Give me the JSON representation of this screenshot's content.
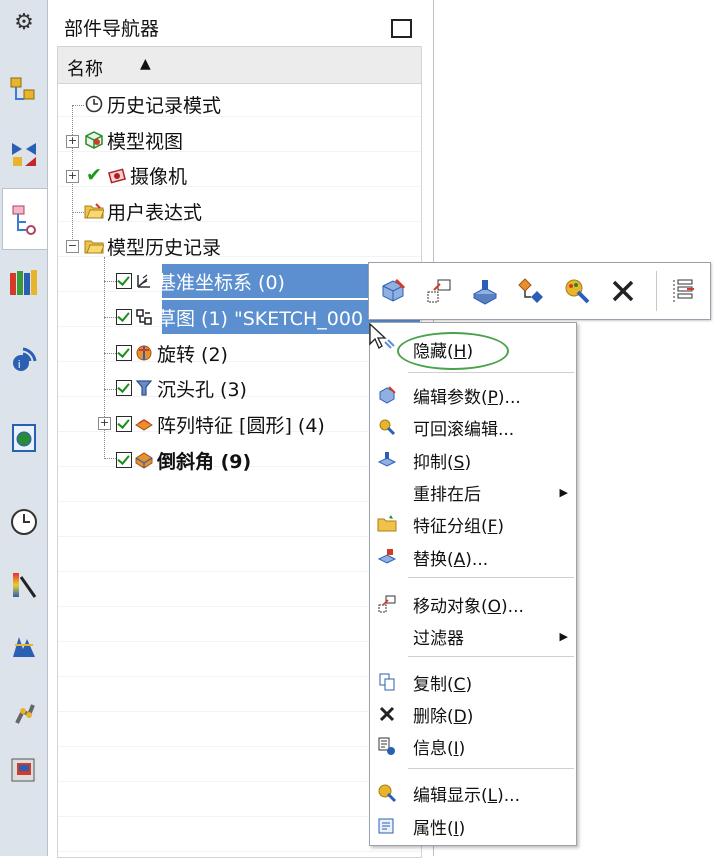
{
  "navigator": {
    "title": "部件导航器",
    "column_header": "名称",
    "nodes": [
      {
        "label": "历史记录模式",
        "icon": "clock-icon"
      },
      {
        "label": "模型视图",
        "icon": "model-view-icon"
      },
      {
        "label": "摄像机",
        "icon": "camera-icon"
      },
      {
        "label": "用户表达式",
        "icon": "folder-icon"
      },
      {
        "label": "模型历史记录",
        "icon": "folder-open-icon"
      },
      {
        "label": "基准坐标系 (0)",
        "icon": "datum-csys-icon"
      },
      {
        "label": "草图 (1) \"SKETCH_000",
        "icon": "sketch-icon"
      },
      {
        "label": "旋转 (2)",
        "icon": "revolve-icon"
      },
      {
        "label": "沉头孔 (3)",
        "icon": "countersink-hole-icon"
      },
      {
        "label": "阵列特征 [圆形] (4)",
        "icon": "pattern-feature-icon"
      },
      {
        "label": "倒斜角 (9)",
        "icon": "chamfer-icon"
      }
    ]
  },
  "context_menu": {
    "items": [
      {
        "label": "隐藏",
        "key": "H"
      },
      {
        "label": "编辑参数",
        "key": "P",
        "suffix": "..."
      },
      {
        "label": "可回滚编辑...",
        "key": "",
        "suffix": ""
      },
      {
        "label": "抑制",
        "key": "S"
      },
      {
        "label": "重排在后",
        "key": ""
      },
      {
        "label": "特征分组",
        "key": "F"
      },
      {
        "label": "替换",
        "key": "A",
        "suffix": "..."
      },
      {
        "label": "移动对象",
        "key": "O",
        "suffix": "..."
      },
      {
        "label": "过滤器",
        "key": ""
      },
      {
        "label": "复制",
        "key": "C"
      },
      {
        "label": "删除",
        "key": "D"
      },
      {
        "label": "信息",
        "key": "I"
      },
      {
        "label": "编辑显示",
        "key": "L",
        "suffix": "..."
      },
      {
        "label": "属性",
        "key": "I"
      }
    ]
  },
  "colors": {
    "selection": "#5b8fd0",
    "highlight_oval": "#4aa24a",
    "check": "#1a8f1a"
  }
}
